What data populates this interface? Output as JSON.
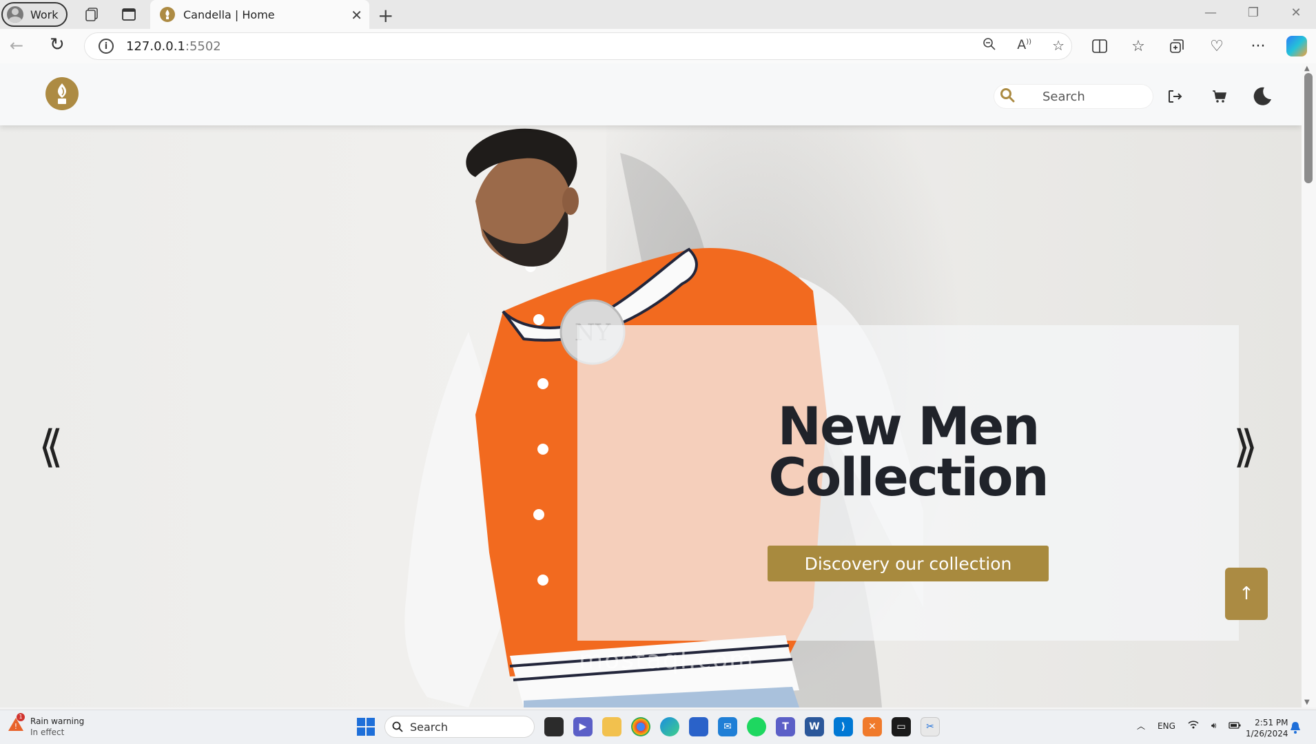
{
  "browser": {
    "profile_label": "Work",
    "tab_title": "Candella | Home",
    "url_host": "127.0.0.1",
    "url_port": ":5502"
  },
  "site": {
    "search_placeholder": "Search"
  },
  "hero": {
    "title_line1": "New Men",
    "title_line2": "Collection",
    "cta_label": "Discovery our collection",
    "prev_arrow": "⟪",
    "next_arrow": "⟫",
    "to_top_label": "↑",
    "watermark": "mostaql.com"
  },
  "colors": {
    "brand": "#ab8b43",
    "jacket_orange": "#f26a1f"
  },
  "taskbar": {
    "weather_title": "Rain warning",
    "weather_sub": "In effect",
    "weather_badge": "1",
    "search_label": "Search",
    "lang": "ENG",
    "time": "2:51 PM",
    "date": "1/26/2024"
  }
}
